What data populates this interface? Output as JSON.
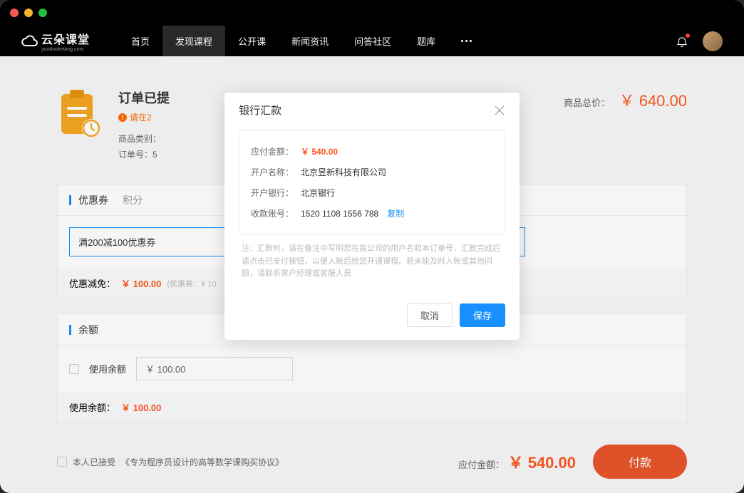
{
  "nav": {
    "logo_text": "云朵课堂",
    "logo_sub": "yunduoketang.com",
    "items": [
      "首页",
      "发现课程",
      "公开课",
      "新闻资讯",
      "问答社区",
      "题库"
    ],
    "active_index": 1
  },
  "order": {
    "title": "订单已提",
    "warn": "请在2",
    "category_label": "商品类别：",
    "number_label": "订单号：5",
    "total_label": "商品总价：",
    "total_value": "￥ 640.00"
  },
  "coupon": {
    "tab1": "优惠券",
    "tab2": "积分",
    "selected": "满200减100优惠券",
    "discount_label": "优惠减免：",
    "discount_value": "￥ 100.00",
    "hint": "(优惠券：¥ 10"
  },
  "balance": {
    "title": "余额",
    "use_label": "使用余额",
    "input_value": "￥ 100.00",
    "used_label": "使用余额：",
    "used_value": "￥ 100.00"
  },
  "footer": {
    "agree_prefix": "本人已接受",
    "agree_link": "《专为程序员设计的高等数学课购买协议》",
    "pay_label": "应付金额：",
    "pay_value": "￥ 540.00",
    "pay_btn": "付款"
  },
  "modal": {
    "title": "银行汇款",
    "rows": {
      "amount_label": "应付金额：",
      "amount_value": "￥ 540.00",
      "account_name_label": "开户名称：",
      "account_name_value": "北京昱新科技有限公司",
      "bank_label": "开户银行：",
      "bank_value": "北京银行",
      "account_no_label": "收款账号：",
      "account_no_value": "1520 1108 1556 788",
      "copy": "复制"
    },
    "note": "注：汇款时，请在备注中写明您在我公司的用户名和本订单号，汇款完成后请点击已支付按钮，以便入账后给您开通课程。若未能及时入账或其他问题，请联系客户经理或客服人员",
    "cancel": "取消",
    "save": "保存"
  }
}
